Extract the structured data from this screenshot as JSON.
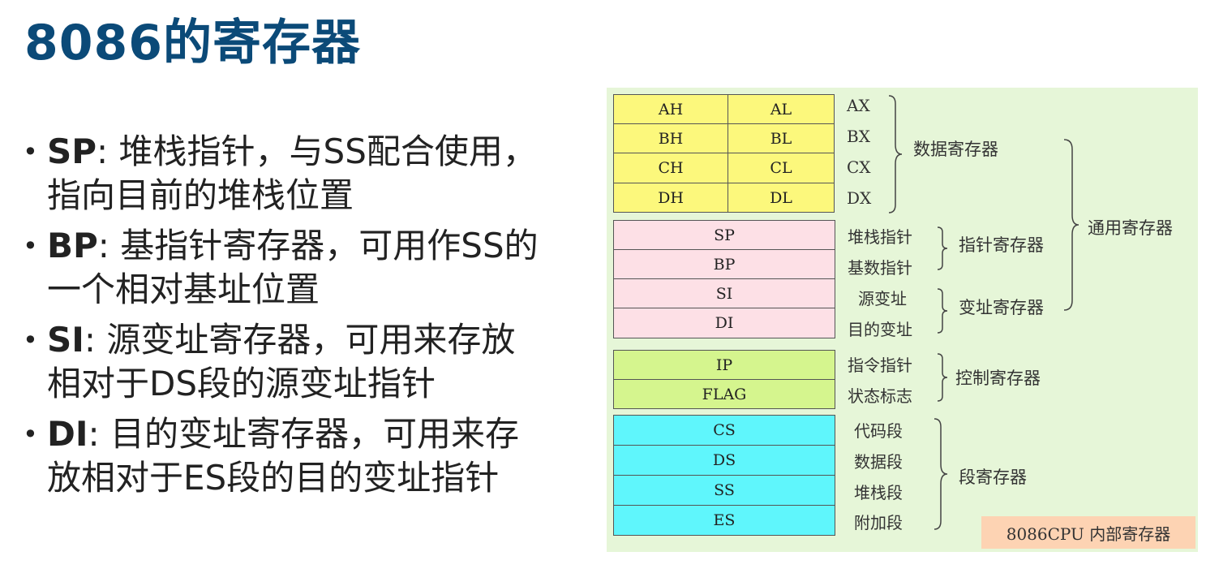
{
  "title": "8086的寄存器",
  "bullets": [
    {
      "key": "SP",
      "text": ": 堆栈指针，与SS配合使用，",
      "text2": "指向目前的堆栈位置"
    },
    {
      "key": "BP",
      "text": ": 基指针寄存器，可用作SS的",
      "text2": "一个相对基址位置"
    },
    {
      "key": "SI",
      "text": ": 源变址寄存器，可用来存放",
      "text2": "相对于DS段的源变址指针"
    },
    {
      "key": "DI",
      "text": ": 目的变址寄存器，可用来存",
      "text2": "放相对于ES段的目的变址指针"
    }
  ],
  "diagram": {
    "data_regs": [
      {
        "hi": "AH",
        "lo": "AL",
        "name": "AX"
      },
      {
        "hi": "BH",
        "lo": "BL",
        "name": "BX"
      },
      {
        "hi": "CH",
        "lo": "CL",
        "name": "CX"
      },
      {
        "hi": "DH",
        "lo": "DL",
        "name": "DX"
      }
    ],
    "pointer_regs": [
      {
        "name": "SP",
        "desc": "堆栈指针"
      },
      {
        "name": "BP",
        "desc": "基数指针"
      }
    ],
    "index_regs": [
      {
        "name": "SI",
        "desc": "源变址"
      },
      {
        "name": "DI",
        "desc": "目的变址"
      }
    ],
    "control_regs": [
      {
        "name": "IP",
        "desc": "指令指针"
      },
      {
        "name": "FLAG",
        "desc": "状态标志"
      }
    ],
    "segment_regs": [
      {
        "name": "CS",
        "desc": "代码段"
      },
      {
        "name": "DS",
        "desc": "数据段"
      },
      {
        "name": "SS",
        "desc": "堆栈段"
      },
      {
        "name": "ES",
        "desc": "附加段"
      }
    ],
    "groups": {
      "data": "数据寄存器",
      "pointer": "指针寄存器",
      "index": "变址寄存器",
      "control": "控制寄存器",
      "segment": "段寄存器",
      "general": "通用寄存器"
    },
    "caption": "8086CPU 内部寄存器",
    "colors": {
      "data": "#fcf87c",
      "pointer": "#fde0e6",
      "control": "#d5f58e",
      "segment": "#5ff6fc",
      "background": "#e6f6d8",
      "title": "#0b4a78"
    }
  }
}
